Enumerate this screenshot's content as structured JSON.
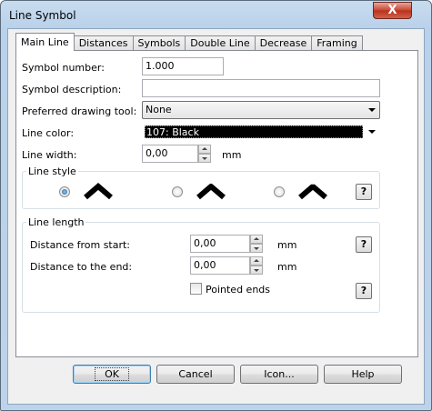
{
  "window": {
    "title": "Line Symbol",
    "close_glyph": "X"
  },
  "tabs": [
    {
      "label": "Main Line",
      "active": true
    },
    {
      "label": "Distances"
    },
    {
      "label": "Symbols"
    },
    {
      "label": "Double Line"
    },
    {
      "label": "Decrease"
    },
    {
      "label": "Framing"
    }
  ],
  "form": {
    "symbol_number_label": "Symbol number:",
    "symbol_number_value": "1.000",
    "symbol_description_label": "Symbol description:",
    "symbol_description_value": "",
    "drawing_tool_label": "Preferred drawing tool:",
    "drawing_tool_value": "None",
    "line_color_label": "Line color:",
    "line_color_value": "107: Black",
    "line_width_label": "Line width:",
    "line_width_value": "0,00",
    "line_width_unit": "mm"
  },
  "line_style": {
    "title": "Line style",
    "selected_index": 0,
    "options": [
      "miter-join",
      "round-join",
      "bevel-join"
    ],
    "help": "?"
  },
  "line_length": {
    "title": "Line length",
    "distance_start_label": "Distance from start:",
    "distance_start_value": "0,00",
    "distance_start_unit": "mm",
    "distance_end_label": "Distance to the end:",
    "distance_end_value": "0,00",
    "distance_end_unit": "mm",
    "pointed_ends_label": "Pointed ends",
    "pointed_ends_checked": false,
    "help": "?"
  },
  "buttons": {
    "ok": "OK",
    "cancel": "Cancel",
    "icon": "Icon...",
    "help": "Help"
  },
  "colors": {
    "line_color_swatch": "#000000",
    "accent": "#3c7fb1"
  }
}
